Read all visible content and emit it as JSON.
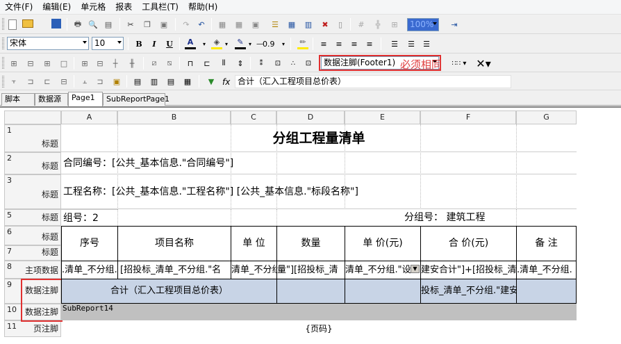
{
  "menu": [
    "文件(F)",
    "编辑(E)",
    "单元格",
    "报表",
    "工具栏(T)",
    "帮助(H)"
  ],
  "font": {
    "name": "宋体",
    "size": "10"
  },
  "toolbar": {
    "line_width": "0.9",
    "zoom": "100%",
    "bold": "B",
    "italic": "I",
    "underline": "U",
    "font_color_letter": "A"
  },
  "section_select": "数据注脚(Footer1)",
  "annotation": "必须相同",
  "formula": {
    "fx": "fx",
    "text": "合计（汇入工程项目总价表）"
  },
  "tabs": [
    "脚本",
    "数据源",
    "Page1",
    "SubReportPage1"
  ],
  "columns": [
    "A",
    "B",
    "C",
    "D",
    "E",
    "F",
    "G"
  ],
  "rows": [
    {
      "num": "1",
      "label": "标题"
    },
    {
      "num": "2",
      "label": "标题"
    },
    {
      "num": "3",
      "label": "标题"
    },
    {
      "num": "5",
      "label": "标题"
    },
    {
      "num": "6",
      "label": "标题"
    },
    {
      "num": "7",
      "label": "标题"
    },
    {
      "num": "8",
      "label": "主项数据"
    },
    {
      "num": "9",
      "label": "数据注脚"
    },
    {
      "num": "10",
      "label": "数据注脚"
    },
    {
      "num": "11",
      "label": "页注脚"
    }
  ],
  "report": {
    "title": "分组工程量清单",
    "contract": "合同编号：[公共_基本信息.\"合同编号\"]",
    "project": "工程名称：[公共_基本信息.\"工程名称\"] [公共_基本信息.\"标段名称\"]",
    "group_no": "组号：2",
    "group_name": "分组号：  建筑工程",
    "headers": [
      "序号",
      "项目名称",
      "单 位",
      "数量",
      "单 价(元)",
      "合 价(元)",
      "备 注"
    ],
    "data_row": [
      ".清单_不分组.",
      "[招投标_清单_不分组.\"名",
      "清单_不分组",
      "量\"][招投标_清",
      "清单_不分组.\"设",
      "建安合计\"]+[招投标_清",
      ".清单_不分组."
    ],
    "footer_total": "合计（汇入工程项目总价表）",
    "footer_f": "投标_清单_不分组.\"建安",
    "subreport": "SubReport14",
    "page": "{页码}"
  }
}
